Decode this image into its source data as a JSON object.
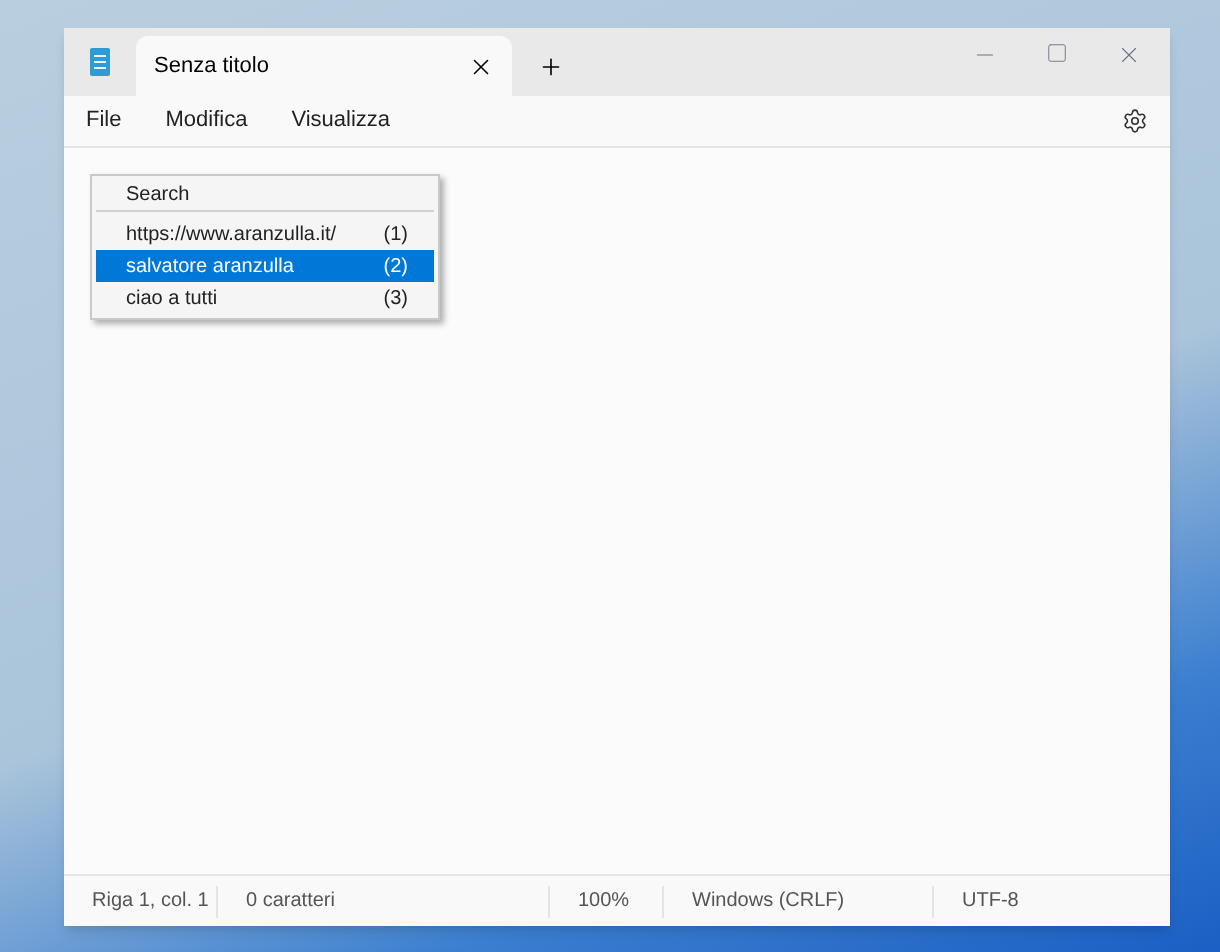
{
  "tabs": [
    {
      "label": "Senza titolo",
      "selected": true
    }
  ],
  "menu_bar": [
    "File",
    "Modifica",
    "Visualizza"
  ],
  "popup_menu": {
    "title": "Search",
    "items": [
      {
        "label": "https://www.aranzulla.it/",
        "shortcut": "(1)",
        "selected": false
      },
      {
        "label": "salvatore aranzulla",
        "shortcut": "(2)",
        "selected": true
      },
      {
        "label": "ciao a tutti",
        "shortcut": "(3)",
        "selected": false
      }
    ]
  },
  "status_bar": [
    "Riga 1, col. 1",
    "0 caratteri",
    "100%",
    "Windows (CRLF)",
    "UTF-8"
  ]
}
